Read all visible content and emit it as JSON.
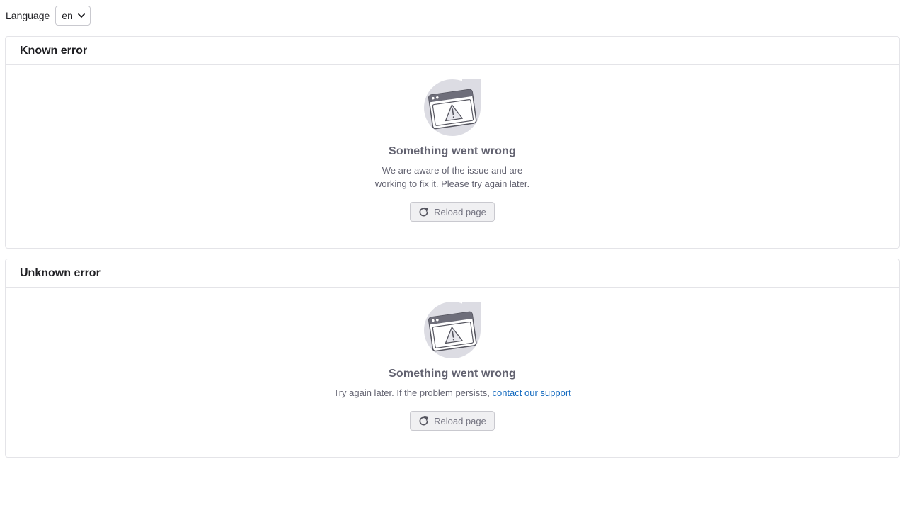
{
  "language": {
    "label": "Language",
    "selected": "en"
  },
  "panels": [
    {
      "title": "Known error",
      "empty_title": "Something went wrong",
      "description_lines": [
        "We are aware of the issue and are",
        "working to fix it. Please try again later."
      ],
      "button_label": "Reload page",
      "illustration_icon": "browser-warning-illustration"
    },
    {
      "title": "Unknown error",
      "empty_title": "Something went wrong",
      "description_text": "Try again later. If the problem persists, ",
      "description_link": "contact our support",
      "button_label": "Reload page",
      "illustration_icon": "browser-warning-illustration"
    }
  ],
  "colors": {
    "link": "#1068bf",
    "muted_text": "#626270",
    "border": "#e4e4e8"
  }
}
